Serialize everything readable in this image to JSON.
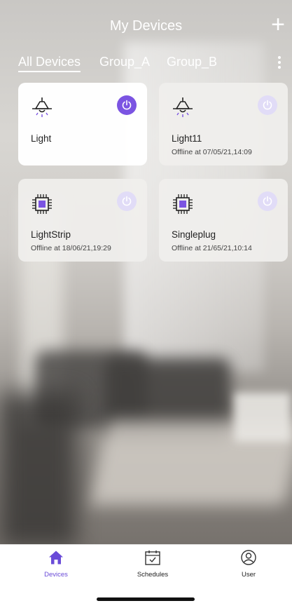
{
  "header": {
    "title": "My Devices",
    "add_label": "+"
  },
  "tabs": [
    {
      "label": "All Devices",
      "active": true
    },
    {
      "label": "Group_A",
      "active": false
    },
    {
      "label": "Group_B",
      "active": false
    }
  ],
  "devices": [
    {
      "name": "Light",
      "status": "",
      "icon": "lamp-icon",
      "power_on": true
    },
    {
      "name": "Light11",
      "status": "Offline at 07/05/21,14:09",
      "icon": "lamp-icon",
      "power_on": false
    },
    {
      "name": "LightStrip",
      "status": "Offline at 18/06/21,19:29",
      "icon": "chip-icon",
      "power_on": false
    },
    {
      "name": "Singleplug",
      "status": "Offline at 21/65/21,10:14",
      "icon": "chip-icon",
      "power_on": false
    }
  ],
  "tabbar": {
    "devices_label": "Devices",
    "schedules_label": "Schedules",
    "user_label": "User"
  },
  "colors": {
    "accent": "#7b54e2",
    "power_off_bg": "#e1dcf7",
    "chip": "#7b54e2"
  }
}
